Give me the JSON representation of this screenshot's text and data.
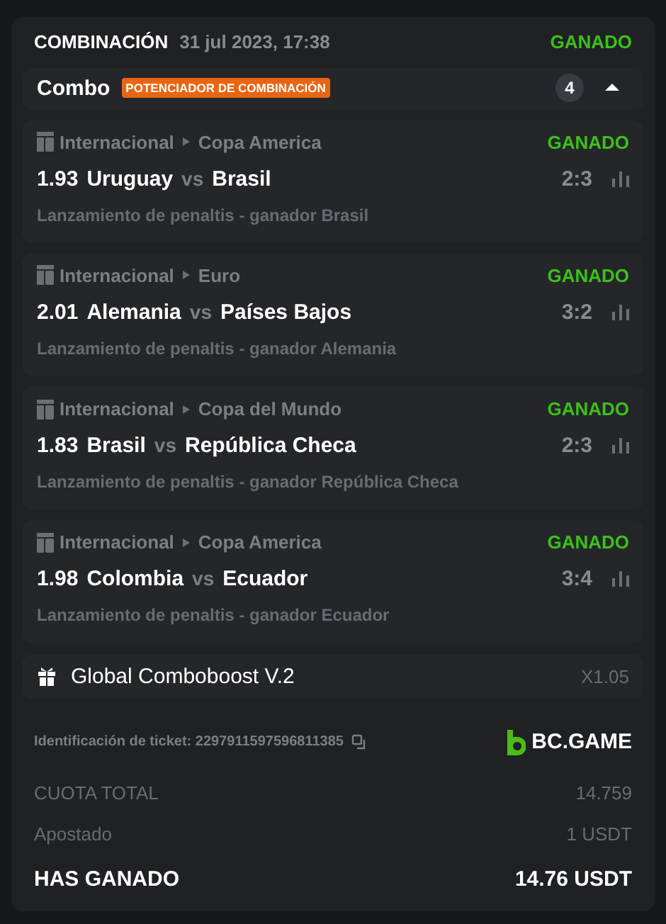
{
  "header": {
    "title": "COMBINACIÓN",
    "date": "31 jul 2023, 17:38",
    "status": "GANADO"
  },
  "combo": {
    "label": "Combo",
    "badge": "POTENCIADOR DE COMBINACIÓN",
    "count": "4",
    "expanded": true
  },
  "bets": [
    {
      "category": "Internacional",
      "league": "Copa America",
      "status": "GANADO",
      "odds": "1.93",
      "home": "Uruguay",
      "vs": "vs",
      "away": "Brasil",
      "score": "2:3",
      "market": "Lanzamiento de penaltis - ganador Brasil"
    },
    {
      "category": "Internacional",
      "league": "Euro",
      "status": "GANADO",
      "odds": "2.01",
      "home": "Alemania",
      "vs": "vs",
      "away": "Países Bajos",
      "score": "3:2",
      "market": "Lanzamiento de penaltis - ganador Alemania"
    },
    {
      "category": "Internacional",
      "league": "Copa del Mundo",
      "status": "GANADO",
      "odds": "1.83",
      "home": "Brasil",
      "vs": "vs",
      "away": "República Checa",
      "score": "2:3",
      "market": "Lanzamiento de penaltis - ganador República Checa"
    },
    {
      "category": "Internacional",
      "league": "Copa America",
      "status": "GANADO",
      "odds": "1.98",
      "home": "Colombia",
      "vs": "vs",
      "away": "Ecuador",
      "score": "3:4",
      "market": "Lanzamiento de penaltis - ganador Ecuador"
    }
  ],
  "boost": {
    "label": "Global Comboboost V.2",
    "multiplier": "X1.05"
  },
  "ticket": {
    "label": "Identificación de ticket: 2297911597596811385",
    "brand": "BC.GAME"
  },
  "summary": [
    {
      "label": "CUOTA TOTAL",
      "value": "14.759",
      "kind": "normal"
    },
    {
      "label": "Apostado",
      "value": "1 USDT",
      "kind": "normal"
    },
    {
      "label": "HAS GANADO",
      "value": "14.76 USDT",
      "kind": "total"
    }
  ]
}
